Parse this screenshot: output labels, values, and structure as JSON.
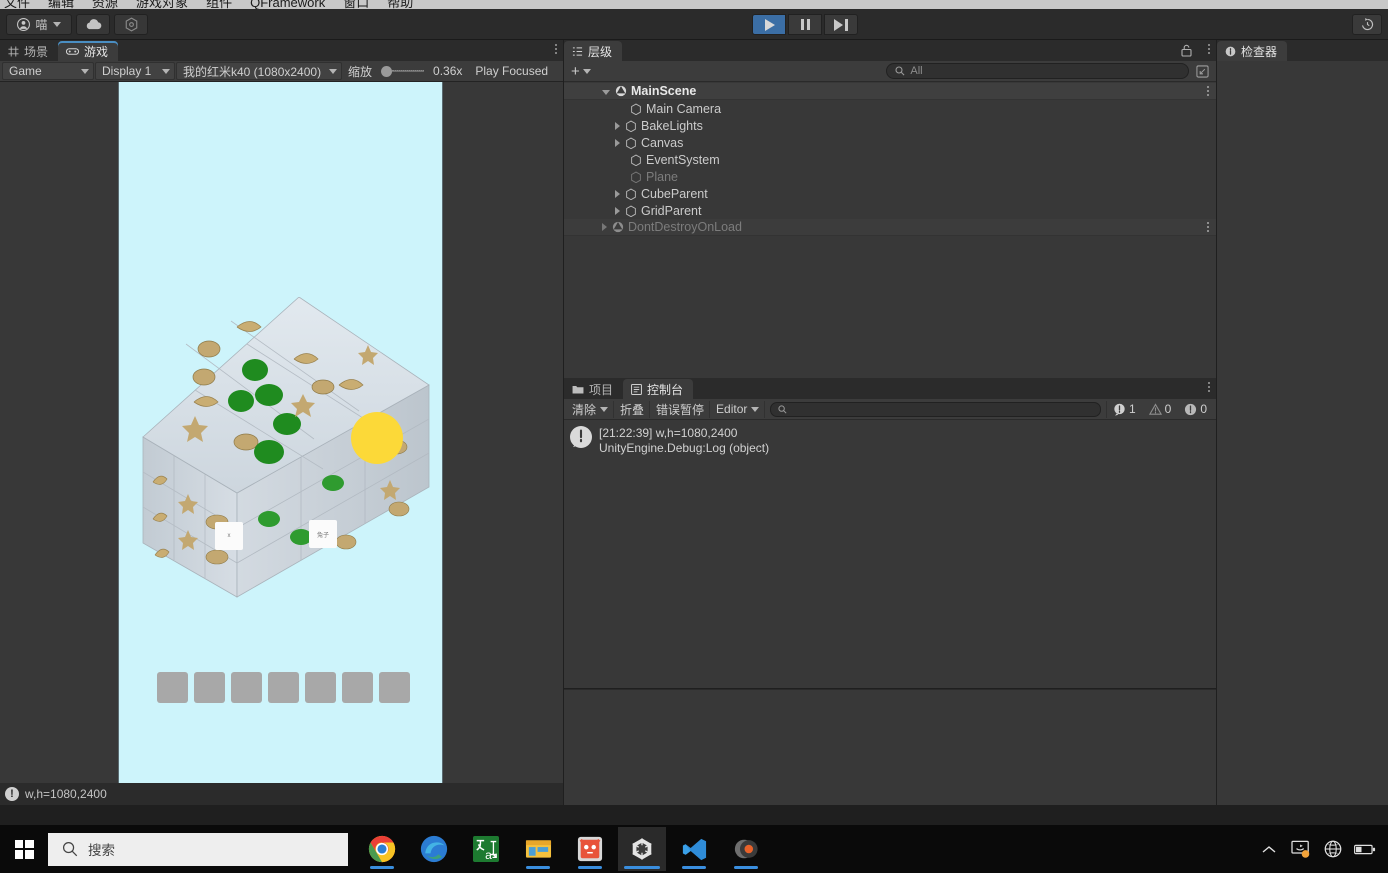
{
  "menubar": {
    "items": [
      "文件",
      "编辑",
      "资源",
      "游戏对象",
      "组件",
      "QFramework",
      "窗口",
      "帮助"
    ]
  },
  "toolbar": {
    "account_label": "喵",
    "cloud_icon": "cloud-icon",
    "package_icon": "package-icon",
    "play_icon": "play-icon",
    "pause_icon": "pause-icon",
    "step_icon": "step-icon",
    "undo_history_icon": "undo-history-icon"
  },
  "gameview": {
    "tabs": [
      {
        "label": "场景",
        "icon": "scene-grid-icon",
        "active": false
      },
      {
        "label": "游戏",
        "icon": "gamepad-icon",
        "active": true
      }
    ],
    "mode_dropdown": "Game",
    "display_dropdown": "Display 1",
    "aspect_dropdown": "我的红米k40 (1080x2400)",
    "zoom_label": "缩放",
    "zoom_value": "0.36x",
    "play_focused": "Play Focused",
    "status_text": "w,h=1080,2400",
    "status_badge": "!",
    "background_color": "#cdf4fb",
    "sun_color": "#fcd938",
    "tray_slot_count": 7,
    "floating_tiles": [
      {
        "label": "x"
      },
      {
        "label": "兔子"
      }
    ]
  },
  "hierarchy": {
    "tab_label": "层级",
    "tab_icon": "hierarchy-icon",
    "lock_icon": "lock-icon",
    "kebab_icon": "kebab-icon",
    "add_label": "+",
    "search_placeholder": "All",
    "search_icon": "search-icon",
    "filter_icon": "filter-window-icon",
    "tree": [
      {
        "label": "MainScene",
        "depth": 0,
        "arrow": "open",
        "icon": "scene-icon",
        "kind": "scene",
        "dim": false
      },
      {
        "label": "Main Camera",
        "depth": 1,
        "arrow": "none",
        "icon": "gameobject-icon",
        "kind": "object",
        "dim": false
      },
      {
        "label": "BakeLights",
        "depth": 1,
        "arrow": "closed",
        "icon": "gameobject-icon",
        "kind": "object",
        "dim": false
      },
      {
        "label": "Canvas",
        "depth": 1,
        "arrow": "closed",
        "icon": "gameobject-icon",
        "kind": "object",
        "dim": false
      },
      {
        "label": "EventSystem",
        "depth": 1,
        "arrow": "none",
        "icon": "gameobject-icon",
        "kind": "object",
        "dim": false
      },
      {
        "label": "Plane",
        "depth": 1,
        "arrow": "none",
        "icon": "gameobject-icon",
        "kind": "object",
        "dim": true
      },
      {
        "label": "CubeParent",
        "depth": 1,
        "arrow": "closed",
        "icon": "gameobject-icon",
        "kind": "object",
        "dim": false
      },
      {
        "label": "GridParent",
        "depth": 1,
        "arrow": "closed",
        "icon": "gameobject-icon",
        "kind": "object",
        "dim": false
      },
      {
        "label": "DontDestroyOnLoad",
        "depth": 0,
        "arrow": "closed",
        "icon": "scene-icon",
        "kind": "scene",
        "dim": true
      }
    ]
  },
  "console": {
    "tabs": [
      {
        "label": "项目",
        "icon": "folder-icon",
        "active": false
      },
      {
        "label": "控制台",
        "icon": "console-icon",
        "active": true
      }
    ],
    "kebab_icon": "kebab-icon",
    "clear_label": "清除",
    "collapse_label": "折叠",
    "error_pause_label": "错误暂停",
    "editor_label": "Editor",
    "search_placeholder": "",
    "search_icon": "search-icon",
    "counts": {
      "errors": "1",
      "warnings": "0",
      "infos": "0"
    },
    "entries": [
      {
        "icon": "error-icon",
        "line1": "[21:22:39] w,h=1080,2400",
        "line2": "UnityEngine.Debug:Log (object)"
      }
    ]
  },
  "inspector": {
    "tab_label": "检查器",
    "tab_icon": "info-icon"
  },
  "taskbar": {
    "start_icon": "windows-start-icon",
    "search_icon": "search-icon",
    "search_placeholder": "搜索",
    "apps": [
      {
        "name": "chrome-icon",
        "running": true,
        "active": false
      },
      {
        "name": "edge-icon",
        "running": false,
        "active": false
      },
      {
        "name": "translate-icon",
        "running": false,
        "active": false
      },
      {
        "name": "explorer-icon",
        "running": true,
        "active": false
      },
      {
        "name": "github-desktop-icon",
        "running": true,
        "active": false
      },
      {
        "name": "unity-icon",
        "running": true,
        "active": true
      },
      {
        "name": "vscode-icon",
        "running": true,
        "active": false
      },
      {
        "name": "recorder-icon",
        "running": true,
        "active": false
      }
    ],
    "tray": [
      {
        "name": "show-hidden-icons-chevron-icon"
      },
      {
        "name": "display-settings-icon"
      },
      {
        "name": "network-globe-icon"
      },
      {
        "name": "battery-icon"
      }
    ]
  }
}
